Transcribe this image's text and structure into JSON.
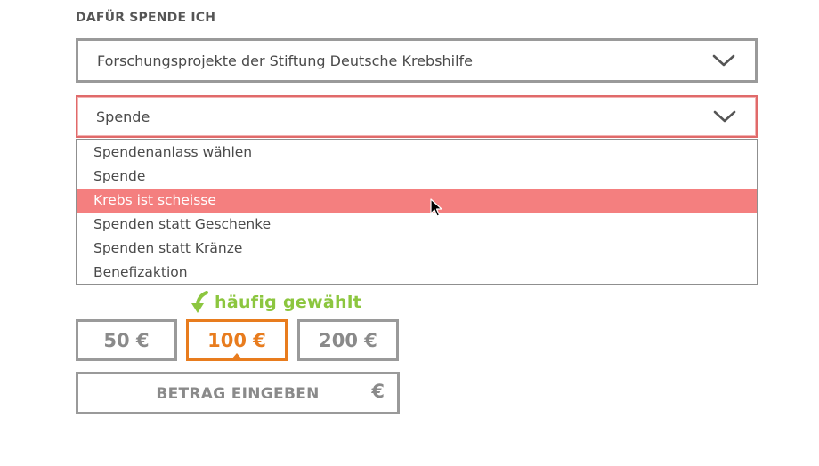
{
  "section_label": "DAFÜR SPENDE ICH",
  "project_select": {
    "value": "Forschungsprojekte der Stiftung Deutsche Krebshilfe",
    "icon": "chevron-down-icon"
  },
  "occasion_select": {
    "value": "Spende",
    "icon": "chevron-down-icon",
    "options": [
      "Spendenanlass wählen",
      "Spende",
      "Krebs ist scheisse",
      "Spenden statt Geschenke",
      "Spenden statt Kränze",
      "Benefizaktion"
    ],
    "highlighted_index": 2
  },
  "popular": {
    "label": "häufig gewählt",
    "icon": "curved-arrow-down-icon"
  },
  "amounts": {
    "a50": "50 €",
    "a100": "100 €",
    "a200": "200 €",
    "selected": "100 €"
  },
  "custom_amount": {
    "placeholder": "BETRAG EINGEBEN",
    "currency": "€"
  },
  "colors": {
    "accent_orange": "#e87c1e",
    "highlight_red": "#f47f7f",
    "popular_green": "#8cc63f",
    "border_grey": "#9a9a9a"
  }
}
